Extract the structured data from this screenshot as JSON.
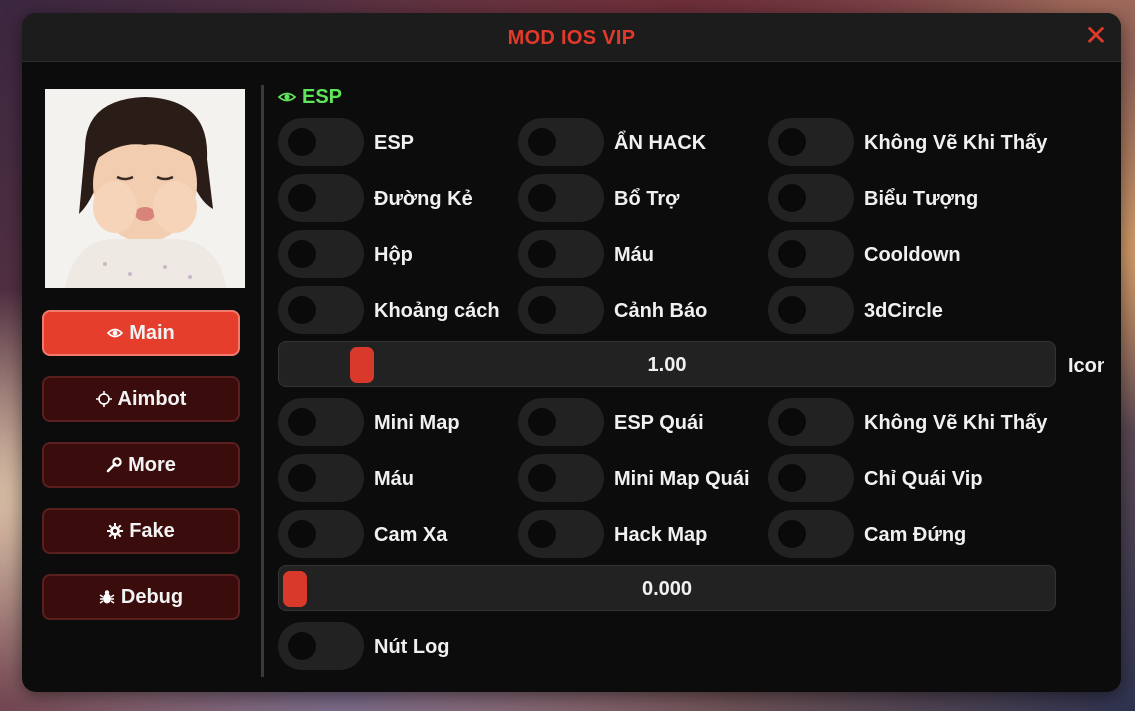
{
  "window": {
    "title": "MOD IOS VIP",
    "close_icon": "close-icon"
  },
  "nav": [
    {
      "label": "Main",
      "icon": "eye-icon",
      "active": true
    },
    {
      "label": "Aimbot",
      "icon": "crosshair-icon",
      "active": false
    },
    {
      "label": "More",
      "icon": "wrench-icon",
      "active": false
    },
    {
      "label": "Fake",
      "icon": "gear-icon",
      "active": false
    },
    {
      "label": "Debug",
      "icon": "bug-icon",
      "active": false
    }
  ],
  "section": {
    "title": "ESP",
    "icon": "eye-icon"
  },
  "toggles_a": [
    [
      "ESP",
      "ẨN HACK",
      "Không Vẽ Khi Thấy"
    ],
    [
      "Đường Kẻ",
      "Bổ Trợ",
      "Biểu Tượng"
    ],
    [
      "Hộp",
      "Máu",
      "Cooldown"
    ],
    [
      "Khoảng cách",
      "Cảnh Báo",
      "3dCircle"
    ]
  ],
  "slider_icon": {
    "value": "1.00",
    "label": "Icon",
    "level": 0.09
  },
  "toggles_b": [
    [
      "Mini Map",
      "ESP Quái",
      "Không Vẽ Khi Thấy"
    ],
    [
      "Máu",
      "Mini Map Quái",
      "Chỉ Quái Vip"
    ],
    [
      "Cam Xa",
      "Hack Map",
      "Cam Đứng"
    ]
  ],
  "slider_cam": {
    "value": "0.000",
    "level": 0.0
  },
  "toggle_log": {
    "label": "Nút Log"
  },
  "colors": {
    "accent": "#e23a2a",
    "active_nav": "#e53e2d",
    "section": "#5ee65a",
    "panel": "#0c0c0c"
  }
}
